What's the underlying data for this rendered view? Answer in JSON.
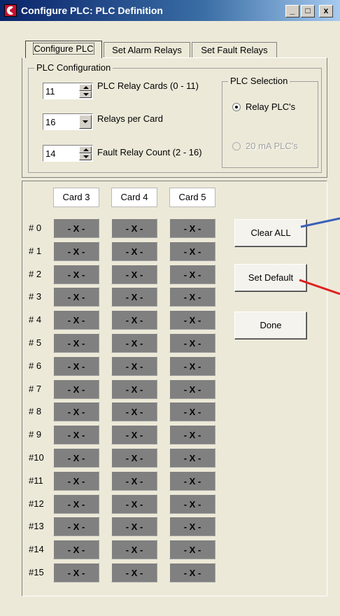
{
  "window": {
    "title": "Configure PLC:  PLC Definition",
    "buttons": [
      "_",
      "□",
      "x"
    ]
  },
  "tabs": [
    {
      "label": "Configure PLC",
      "active": true
    },
    {
      "label": "Set Alarm Relays",
      "active": false
    },
    {
      "label": "Set Fault Relays",
      "active": false
    }
  ],
  "plc_config": {
    "group_title": "PLC Configuration",
    "relay_cards": {
      "value": "11",
      "label": "PLC Relay Cards (0 - 11)"
    },
    "relays_per_card": {
      "value": "16",
      "label": "Relays per Card"
    },
    "fault_relay_count": {
      "value": "14",
      "label": "Fault Relay Count (2 - 16)"
    }
  },
  "plc_selection": {
    "group_title": "PLC Selection",
    "options": [
      {
        "label": "Relay PLC's",
        "checked": true,
        "enabled": true
      },
      {
        "label": "20 mA PLC's",
        "checked": false,
        "enabled": false
      }
    ]
  },
  "grid": {
    "columns": [
      "Card 3",
      "Card 4",
      "Card 5"
    ],
    "rows": [
      "# 0",
      "# 1",
      "# 2",
      "# 3",
      "# 4",
      "# 5",
      "# 6",
      "# 7",
      "# 8",
      "# 9",
      "#10",
      "#11",
      "#12",
      "#13",
      "#14",
      "#15"
    ],
    "cell_text": "- X -"
  },
  "buttons": {
    "clear_all": "Clear ALL",
    "set_default": "Set Default",
    "done": "Done"
  },
  "colors": {
    "arrow_blue": "#3a5fb8",
    "arrow_red": "#e02020",
    "cell_gray": "#808080"
  },
  "icons": {
    "app": "app-logo-icon"
  }
}
